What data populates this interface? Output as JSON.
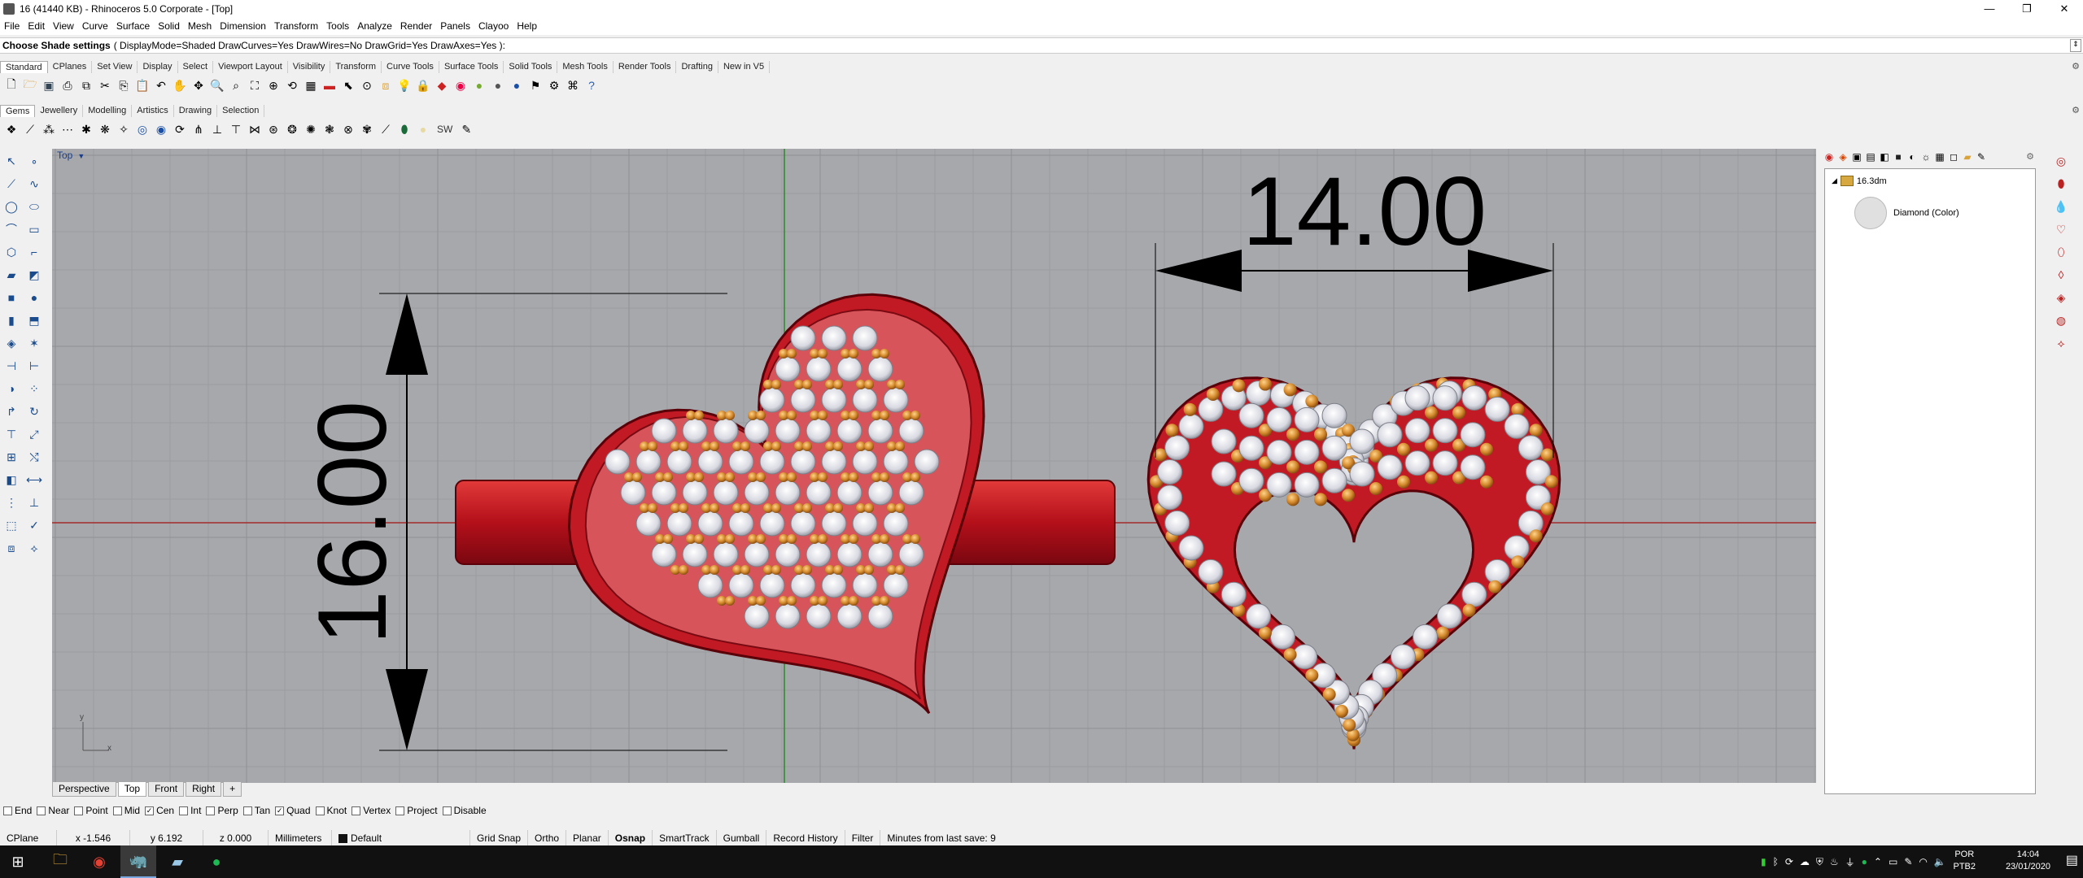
{
  "window": {
    "title": "16 (41440 KB) - Rhinoceros  5.0 Corporate - [Top]",
    "minimize": "—",
    "maximize": "❐",
    "close": "✕"
  },
  "menu": [
    "File",
    "Edit",
    "View",
    "Curve",
    "Surface",
    "Solid",
    "Mesh",
    "Dimension",
    "Transform",
    "Tools",
    "Analyze",
    "Render",
    "Panels",
    "Clayoo",
    "Help"
  ],
  "command": {
    "prompt": "Choose Shade settings",
    "options": "( DisplayMode=Shaded  DrawCurves=Yes  DrawWires=No  DrawGrid=Yes  DrawAxes=Yes ):"
  },
  "toolbar_tabs_1": [
    "Standard",
    "CPlanes",
    "Set View",
    "Display",
    "Select",
    "Viewport Layout",
    "Visibility",
    "Transform",
    "Curve Tools",
    "Surface Tools",
    "Solid Tools",
    "Mesh Tools",
    "Render Tools",
    "Drafting",
    "New in V5"
  ],
  "toolbar_tabs_2": [
    "Gems",
    "Jewellery",
    "Modelling",
    "Artistics",
    "Drawing",
    "Selection"
  ],
  "toolbar2_text": "SW",
  "viewport": {
    "label": "Top",
    "dim_width": "14.00",
    "dim_height": "16.00"
  },
  "viewport_tabs": [
    "Perspective",
    "Top",
    "Front",
    "Right"
  ],
  "viewport_tabs_add": "+",
  "panel": {
    "root": "16.3dm",
    "child": "Diamond (Color)"
  },
  "osnaps": [
    {
      "label": "End",
      "checked": false
    },
    {
      "label": "Near",
      "checked": false
    },
    {
      "label": "Point",
      "checked": false
    },
    {
      "label": "Mid",
      "checked": false
    },
    {
      "label": "Cen",
      "checked": true
    },
    {
      "label": "Int",
      "checked": false
    },
    {
      "label": "Perp",
      "checked": false
    },
    {
      "label": "Tan",
      "checked": false
    },
    {
      "label": "Quad",
      "checked": true
    },
    {
      "label": "Knot",
      "checked": false
    },
    {
      "label": "Vertex",
      "checked": false
    },
    {
      "label": "Project",
      "checked": false
    },
    {
      "label": "Disable",
      "checked": false
    }
  ],
  "status": {
    "cplane": "CPlane",
    "x": "x -1.546",
    "y": "y 6.192",
    "z": "z 0.000",
    "units": "Millimeters",
    "layer": "Default",
    "grid_snap": "Grid Snap",
    "ortho": "Ortho",
    "planar": "Planar",
    "osnap": "Osnap",
    "smarttrack": "SmartTrack",
    "gumball": "Gumball",
    "record_history": "Record History",
    "filter": "Filter",
    "save_info": "Minutes from last save: 9"
  },
  "taskbar": {
    "lang1": "POR",
    "lang2": "PTB2",
    "time": "14:04",
    "date": "23/01/2020"
  },
  "colors": {
    "viewport_bg": "#a6a8ab",
    "ring_red": "#c0141c",
    "gem_gold": "#d4892c",
    "diamond": "#e8e8ee"
  }
}
